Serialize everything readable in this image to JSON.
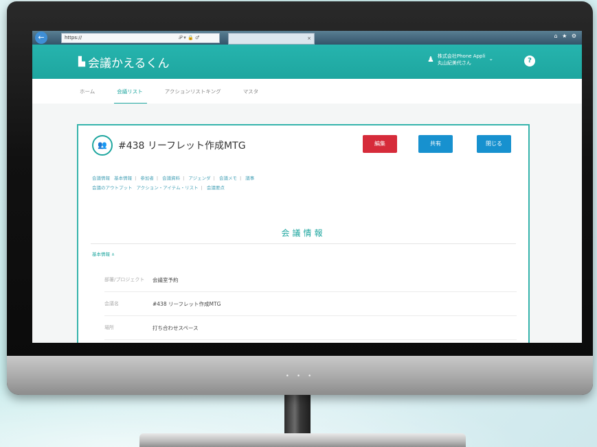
{
  "browser": {
    "back_icon": "arrow-left-icon",
    "address": "https://",
    "address_controls": "𝒫 ▾ 🔒 ♂",
    "tab_label": "×",
    "window_controls": "⌂ ★ ⚙"
  },
  "app": {
    "title": "会議かえるくん",
    "logo_icon": "building-icon",
    "company": "株式会社Phone Appli",
    "user": "丸山紀美代さん",
    "help": "?"
  },
  "nav": {
    "items": [
      "ホーム",
      "会議リスト",
      "アクションリストキング",
      "マスタ"
    ],
    "active": 1
  },
  "meeting": {
    "icon": "group-icon",
    "title": "#438 リーフレット作成MTG",
    "buttons": {
      "edit": "編集",
      "share": "共有",
      "close": "閉じる"
    }
  },
  "links": {
    "line1": [
      "会議情報",
      "基本情報",
      "参加者",
      "会議資料",
      "アジェンダ",
      "会議メモ",
      "議事"
    ],
    "line2": [
      "会議のアウトプット",
      "アクション・アイテム・リスト",
      "会議要点"
    ]
  },
  "section": {
    "title": "会議情報",
    "fold_label": "基本情報 ∧",
    "rows": [
      {
        "label": "部署/プロジェクト",
        "value": "会議室予約"
      },
      {
        "label": "会議名",
        "value": "#438 リーフレット作成MTG"
      },
      {
        "label": "場所",
        "value": "打ち合わせスペース"
      }
    ]
  },
  "monitor": {
    "indicator": "• • •"
  }
}
